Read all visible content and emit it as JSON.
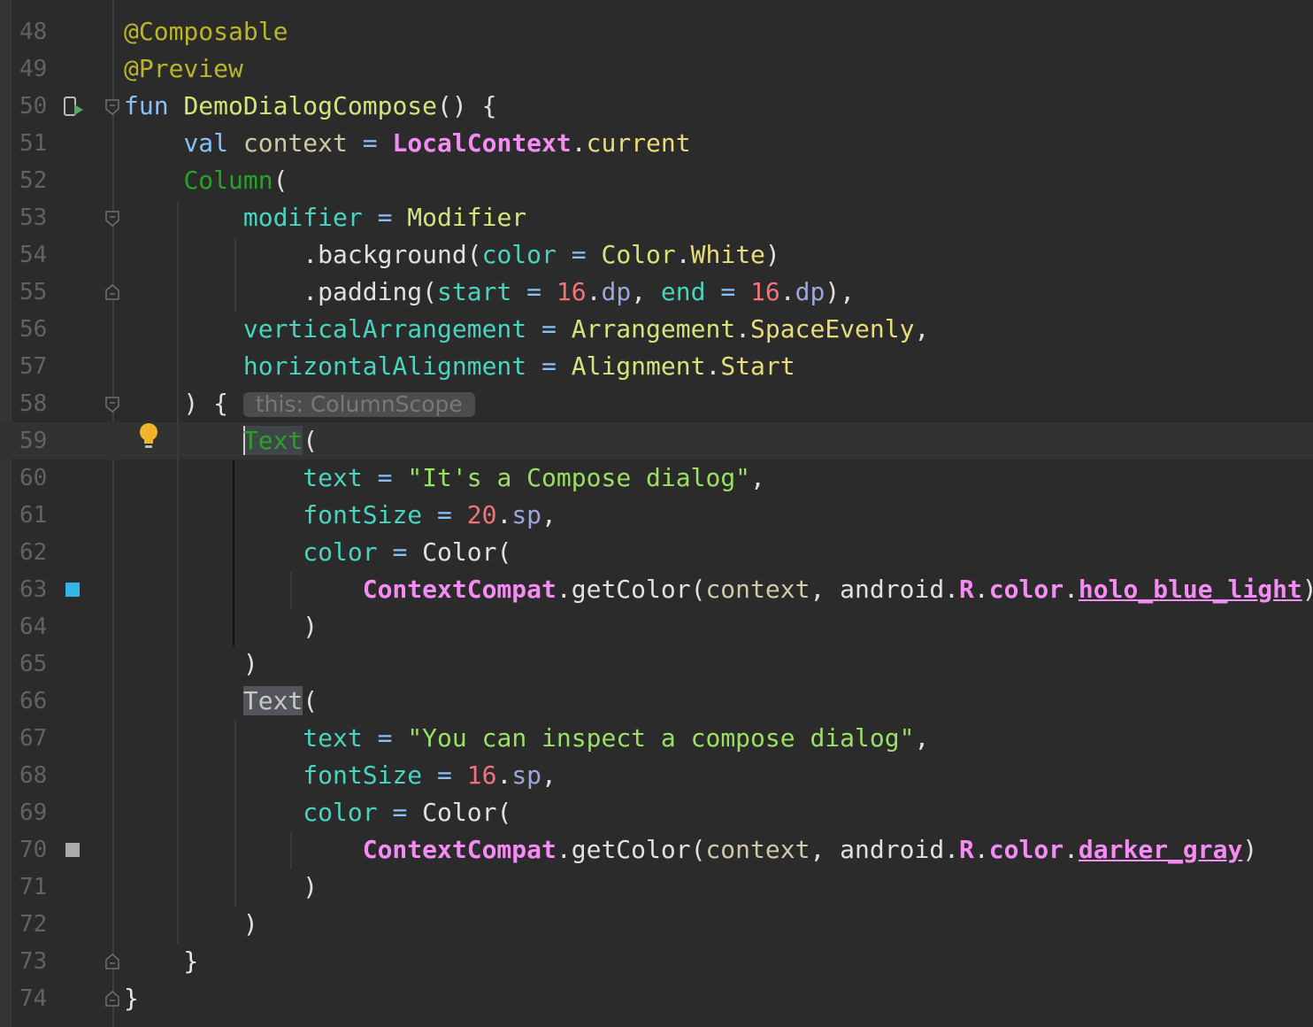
{
  "editor": {
    "lines": [
      {
        "number": "48",
        "segments": [
          {
            "t": "@Composable",
            "c": "ann"
          }
        ]
      },
      {
        "number": "49",
        "segments": [
          {
            "t": "@Preview",
            "c": "ann"
          }
        ]
      },
      {
        "number": "50",
        "segments": [
          {
            "t": "fun ",
            "c": "kw"
          },
          {
            "t": "DemoDialogCompose",
            "c": "fn2"
          },
          {
            "t": "() {",
            "c": "plain"
          }
        ]
      },
      {
        "number": "51",
        "segments": [
          {
            "t": "    ",
            "c": "plain"
          },
          {
            "t": "val ",
            "c": "kw"
          },
          {
            "t": "context",
            "c": "var"
          },
          {
            "t": " = ",
            "c": "kw"
          },
          {
            "t": "LocalContext",
            "c": "pink b"
          },
          {
            "t": ".",
            "c": "plain"
          },
          {
            "t": "current",
            "c": "prop"
          }
        ]
      },
      {
        "number": "52",
        "segments": [
          {
            "t": "    ",
            "c": "plain"
          },
          {
            "t": "Column",
            "c": "comp"
          },
          {
            "t": "(",
            "c": "plain"
          }
        ]
      },
      {
        "number": "53",
        "segments": [
          {
            "t": "        ",
            "c": "plain"
          },
          {
            "t": "modifier",
            "c": "nparam"
          },
          {
            "t": " = ",
            "c": "kw"
          },
          {
            "t": "Modifier",
            "c": "fn2"
          }
        ]
      },
      {
        "number": "54",
        "segments": [
          {
            "t": "            ",
            "c": "plain"
          },
          {
            "t": ".background(",
            "c": "plain"
          },
          {
            "t": "color",
            "c": "nparam"
          },
          {
            "t": " = ",
            "c": "kw"
          },
          {
            "t": "Color",
            "c": "fn2"
          },
          {
            "t": ".",
            "c": "plain"
          },
          {
            "t": "White",
            "c": "prop"
          },
          {
            "t": ")",
            "c": "plain"
          }
        ]
      },
      {
        "number": "55",
        "segments": [
          {
            "t": "            ",
            "c": "plain"
          },
          {
            "t": ".padding(",
            "c": "plain"
          },
          {
            "t": "start",
            "c": "nparam"
          },
          {
            "t": " = ",
            "c": "kw"
          },
          {
            "t": "16",
            "c": "num"
          },
          {
            "t": ".",
            "c": "plain"
          },
          {
            "t": "dp",
            "c": "unit"
          },
          {
            "t": ", ",
            "c": "plain"
          },
          {
            "t": "end",
            "c": "nparam"
          },
          {
            "t": " = ",
            "c": "kw"
          },
          {
            "t": "16",
            "c": "num"
          },
          {
            "t": ".",
            "c": "plain"
          },
          {
            "t": "dp",
            "c": "unit"
          },
          {
            "t": "),",
            "c": "plain"
          }
        ]
      },
      {
        "number": "56",
        "segments": [
          {
            "t": "        ",
            "c": "plain"
          },
          {
            "t": "verticalArrangement",
            "c": "nparam"
          },
          {
            "t": " = ",
            "c": "kw"
          },
          {
            "t": "Arrangement",
            "c": "fn2"
          },
          {
            "t": ".",
            "c": "plain"
          },
          {
            "t": "SpaceEvenly",
            "c": "prop"
          },
          {
            "t": ",",
            "c": "plain"
          }
        ]
      },
      {
        "number": "57",
        "segments": [
          {
            "t": "        ",
            "c": "plain"
          },
          {
            "t": "horizontalAlignment",
            "c": "nparam"
          },
          {
            "t": " = ",
            "c": "kw"
          },
          {
            "t": "Alignment",
            "c": "fn2"
          },
          {
            "t": ".",
            "c": "plain"
          },
          {
            "t": "Start",
            "c": "prop"
          }
        ]
      },
      {
        "number": "58",
        "segments": [
          {
            "t": "    ) { ",
            "c": "plain"
          }
        ],
        "hint": "this: ColumnScope"
      },
      {
        "number": "59",
        "segments": [
          {
            "t": "        ",
            "c": "plain"
          },
          {
            "t": "Text",
            "c": "hl-green"
          },
          {
            "t": "(",
            "c": "plain"
          }
        ],
        "current": true
      },
      {
        "number": "60",
        "segments": [
          {
            "t": "            ",
            "c": "plain"
          },
          {
            "t": "text",
            "c": "nparam"
          },
          {
            "t": " = ",
            "c": "kw"
          },
          {
            "t": "\"It's a Compose dialog\"",
            "c": "str"
          },
          {
            "t": ",",
            "c": "plain"
          }
        ]
      },
      {
        "number": "61",
        "segments": [
          {
            "t": "            ",
            "c": "plain"
          },
          {
            "t": "fontSize",
            "c": "nparam"
          },
          {
            "t": " = ",
            "c": "kw"
          },
          {
            "t": "20",
            "c": "num"
          },
          {
            "t": ".",
            "c": "plain"
          },
          {
            "t": "sp",
            "c": "unit"
          },
          {
            "t": ",",
            "c": "plain"
          }
        ]
      },
      {
        "number": "62",
        "segments": [
          {
            "t": "            ",
            "c": "plain"
          },
          {
            "t": "color",
            "c": "nparam"
          },
          {
            "t": " = ",
            "c": "kw"
          },
          {
            "t": "Color(",
            "c": "plain"
          }
        ]
      },
      {
        "number": "63",
        "segments": [
          {
            "t": "                ",
            "c": "plain"
          },
          {
            "t": "ContextCompat",
            "c": "pink b"
          },
          {
            "t": ".getColor(",
            "c": "plain"
          },
          {
            "t": "context",
            "c": "var"
          },
          {
            "t": ", android.",
            "c": "plain"
          },
          {
            "t": "R",
            "c": "pink b"
          },
          {
            "t": ".",
            "c": "plain"
          },
          {
            "t": "color",
            "c": "pink b"
          },
          {
            "t": ".",
            "c": "plain"
          },
          {
            "t": "holo_blue_light",
            "c": "pink b u"
          },
          {
            "t": ")",
            "c": "plain"
          }
        ],
        "swatch": "#33b5e5"
      },
      {
        "number": "64",
        "segments": [
          {
            "t": "            )",
            "c": "plain"
          }
        ]
      },
      {
        "number": "65",
        "segments": [
          {
            "t": "        )",
            "c": "plain"
          }
        ]
      },
      {
        "number": "66",
        "segments": [
          {
            "t": "        ",
            "c": "plain"
          },
          {
            "t": "Text",
            "c": "hl-gray"
          },
          {
            "t": "(",
            "c": "plain"
          }
        ]
      },
      {
        "number": "67",
        "segments": [
          {
            "t": "            ",
            "c": "plain"
          },
          {
            "t": "text",
            "c": "nparam"
          },
          {
            "t": " = ",
            "c": "kw"
          },
          {
            "t": "\"You can inspect a compose dialog\"",
            "c": "str"
          },
          {
            "t": ",",
            "c": "plain"
          }
        ]
      },
      {
        "number": "68",
        "segments": [
          {
            "t": "            ",
            "c": "plain"
          },
          {
            "t": "fontSize",
            "c": "nparam"
          },
          {
            "t": " = ",
            "c": "kw"
          },
          {
            "t": "16",
            "c": "num"
          },
          {
            "t": ".",
            "c": "plain"
          },
          {
            "t": "sp",
            "c": "unit"
          },
          {
            "t": ",",
            "c": "plain"
          }
        ]
      },
      {
        "number": "69",
        "segments": [
          {
            "t": "            ",
            "c": "plain"
          },
          {
            "t": "color",
            "c": "nparam"
          },
          {
            "t": " = ",
            "c": "kw"
          },
          {
            "t": "Color(",
            "c": "plain"
          }
        ]
      },
      {
        "number": "70",
        "segments": [
          {
            "t": "                ",
            "c": "plain"
          },
          {
            "t": "ContextCompat",
            "c": "pink b"
          },
          {
            "t": ".getColor(",
            "c": "plain"
          },
          {
            "t": "context",
            "c": "var"
          },
          {
            "t": ", android.",
            "c": "plain"
          },
          {
            "t": "R",
            "c": "pink b"
          },
          {
            "t": ".",
            "c": "plain"
          },
          {
            "t": "color",
            "c": "pink b"
          },
          {
            "t": ".",
            "c": "plain"
          },
          {
            "t": "darker_gray",
            "c": "pink b u"
          },
          {
            "t": ")",
            "c": "plain"
          }
        ],
        "swatch": "#aaaaaa"
      },
      {
        "number": "71",
        "segments": [
          {
            "t": "            )",
            "c": "plain"
          }
        ]
      },
      {
        "number": "72",
        "segments": [
          {
            "t": "        )",
            "c": "plain"
          }
        ]
      },
      {
        "number": "73",
        "segments": [
          {
            "t": "    }",
            "c": "white"
          }
        ]
      },
      {
        "number": "74",
        "segments": [
          {
            "t": "}",
            "c": "white"
          }
        ]
      }
    ],
    "gutter_icons": {
      "preview_run_icon_line": "50",
      "intention_bulb_icon_line": "59",
      "bulb_color": "#f0b428",
      "run_arrow_color": "#59a869"
    }
  }
}
